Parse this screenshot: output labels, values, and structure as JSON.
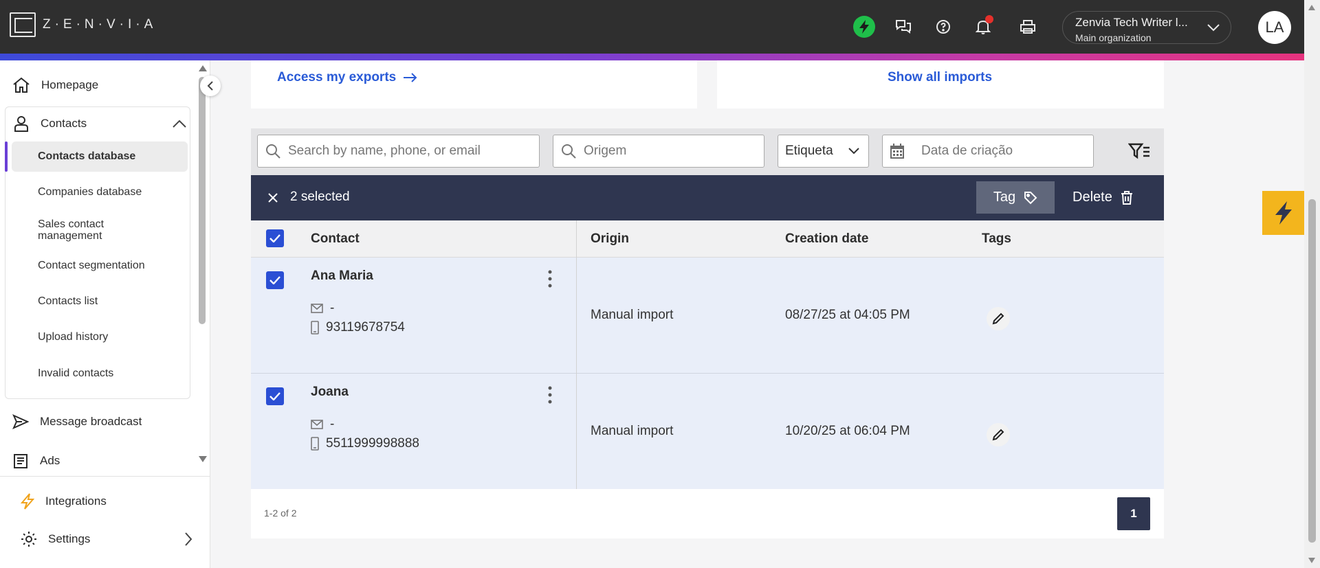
{
  "app": {
    "logo_text": "Z·E·N·V·I·A"
  },
  "header": {
    "org_name": "Zenvia Tech Writer l...",
    "org_sub": "Main organization",
    "avatar_initials": "LA",
    "icons": [
      "lightning-icon",
      "chat-icon",
      "help-icon",
      "bell-icon",
      "printer-icon"
    ]
  },
  "sidebar": {
    "homepage": "Homepage",
    "contacts": "Contacts",
    "sub_items": [
      "Contacts database",
      "Companies database",
      "Sales contact management",
      "Contact segmentation",
      "Contacts list",
      "Upload history",
      "Invalid contacts"
    ],
    "broadcast": "Message broadcast",
    "ads": "Ads",
    "integrations": "Integrations",
    "settings": "Settings"
  },
  "cards": {
    "exports_link": "Access my exports",
    "imports_link": "Show all imports"
  },
  "filters": {
    "search_placeholder": "Search by name, phone, or email",
    "origin_placeholder": "Origem",
    "tag_select": "Etiqueta",
    "date_placeholder": "Data de criação"
  },
  "selection": {
    "label": "2 selected",
    "tag_button": "Tag",
    "delete_button": "Delete"
  },
  "table": {
    "headers": [
      "Contact",
      "Origin",
      "Creation date",
      "Tags"
    ],
    "rows": [
      {
        "name": "Ana Maria",
        "email": "-",
        "phone": "93119678754",
        "origin": "Manual import",
        "date": "08/27/25 at 04:05 PM"
      },
      {
        "name": "Joana",
        "email": "-",
        "phone": "5511999998888",
        "origin": "Manual import",
        "date": "10/20/25 at 06:04 PM"
      }
    ]
  },
  "pagination": {
    "info": "1-2 of 2",
    "page": "1"
  },
  "colors": {
    "topbar": "#2f2f2f",
    "accent_blue": "#2a5bd7",
    "selection_bar": "#2f3650",
    "checkbox": "#2a4ed4",
    "bolt_green": "#1fbf4a",
    "bolt_yellow": "#f3b51d"
  }
}
